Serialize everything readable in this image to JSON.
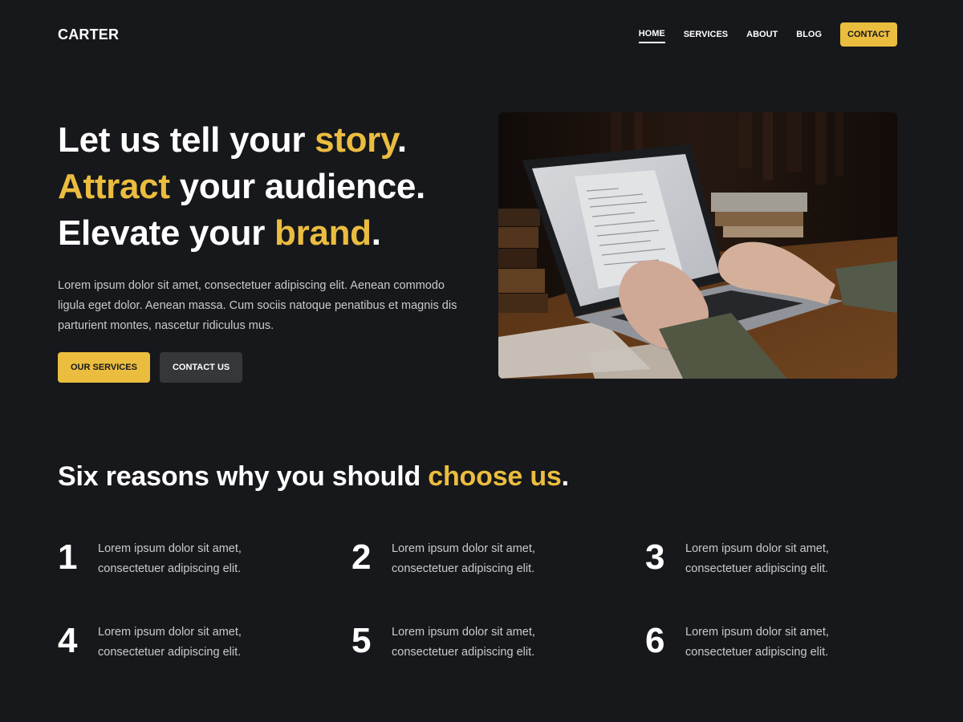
{
  "header": {
    "logo": "CARTER",
    "nav": [
      {
        "label": "HOME",
        "active": true
      },
      {
        "label": "SERVICES",
        "active": false
      },
      {
        "label": "ABOUT",
        "active": false
      },
      {
        "label": "BLOG",
        "active": false
      }
    ],
    "cta": "CONTACT"
  },
  "hero": {
    "line1": {
      "pre": "Let us tell your ",
      "accent": "story",
      "post": "."
    },
    "line2": {
      "accent": "Attract",
      "post": " your audience."
    },
    "line3": {
      "pre": "Elevate your ",
      "accent": "brand",
      "post": "."
    },
    "description": "Lorem ipsum dolor sit amet, consectetuer adipiscing elit. Aenean commodo ligula eget dolor. Aenean massa. Cum sociis natoque penatibus et magnis dis parturient montes, nascetur ridiculus mus.",
    "primary_button": "OUR SERVICES",
    "secondary_button": "CONTACT US"
  },
  "reasons": {
    "title_pre": "Six reasons why you should ",
    "title_accent": "choose us",
    "title_post": ".",
    "items": [
      {
        "number": "1",
        "text": "Lorem ipsum dolor sit amet, consectetuer adipiscing elit."
      },
      {
        "number": "2",
        "text": "Lorem ipsum dolor sit amet, consectetuer adipiscing elit."
      },
      {
        "number": "3",
        "text": "Lorem ipsum dolor sit amet, consectetuer adipiscing elit."
      },
      {
        "number": "4",
        "text": "Lorem ipsum dolor sit amet, consectetuer adipiscing elit."
      },
      {
        "number": "5",
        "text": "Lorem ipsum dolor sit amet, consectetuer adipiscing elit."
      },
      {
        "number": "6",
        "text": "Lorem ipsum dolor sit amet, consectetuer adipiscing elit."
      }
    ]
  },
  "colors": {
    "accent": "#ebbd3f",
    "background": "#17181b",
    "secondary_button": "#36373b"
  }
}
